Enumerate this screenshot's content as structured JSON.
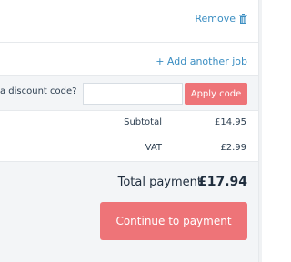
{
  "item_actions": {
    "remove_label": "Remove",
    "remove_icon": "trash-icon"
  },
  "jobs": {
    "add_another_label": "+ Add another job"
  },
  "discount": {
    "label": "a discount code?",
    "input_value": "",
    "input_placeholder": "",
    "apply_label": "Apply code"
  },
  "summary": {
    "subtotal_label": "Subtotal",
    "subtotal_value": "£14.95",
    "vat_label": "VAT",
    "vat_value": "£2.99",
    "total_label": "Total payment",
    "total_value": "£17.94"
  },
  "checkout": {
    "continue_label": "Continue to payment"
  },
  "colors": {
    "accent": "#ee7478",
    "link": "#3b8ec2",
    "panel": "#f3f5f7"
  }
}
